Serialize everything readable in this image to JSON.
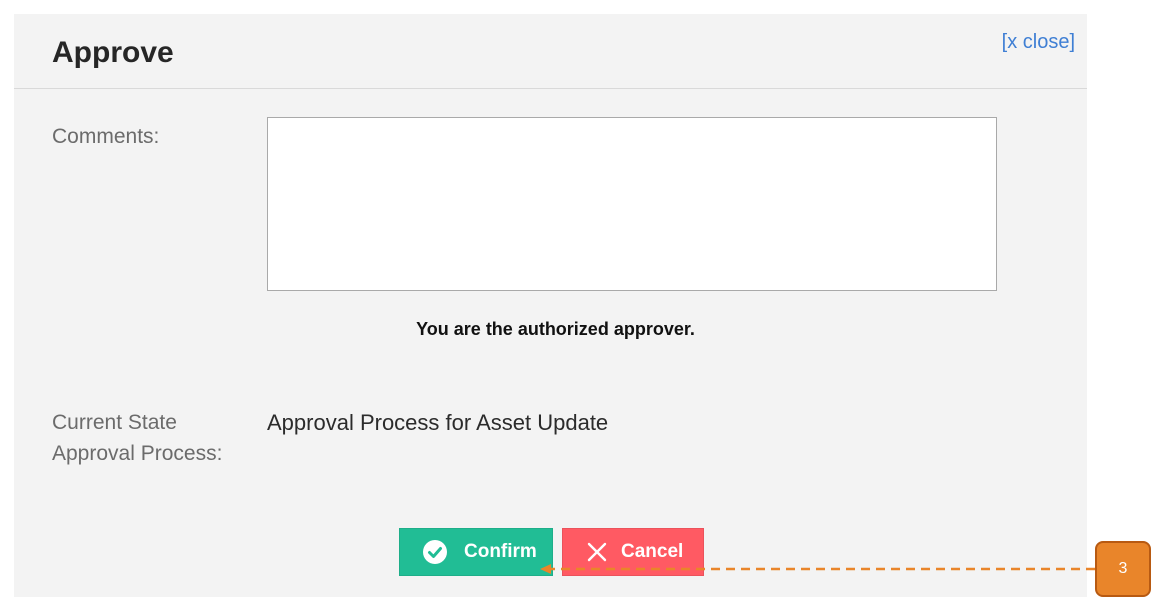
{
  "dialog": {
    "title": "Approve",
    "close_label": "[x close]",
    "comments_label": "Comments:",
    "comments_value": "",
    "approver_message": "You are the authorized approver.",
    "state_label_line1": "Current State",
    "state_label_line2": "Approval Process:",
    "state_value": "Approval Process for Asset Update"
  },
  "buttons": {
    "confirm_label": "Confirm",
    "confirm_icon": "check-circle-icon",
    "confirm_color": "#21bd95",
    "cancel_label": "Cancel",
    "cancel_icon": "x-icon",
    "cancel_color": "#ff5a63"
  },
  "annotation": {
    "badge_label": "3",
    "color": "#e9852a"
  }
}
